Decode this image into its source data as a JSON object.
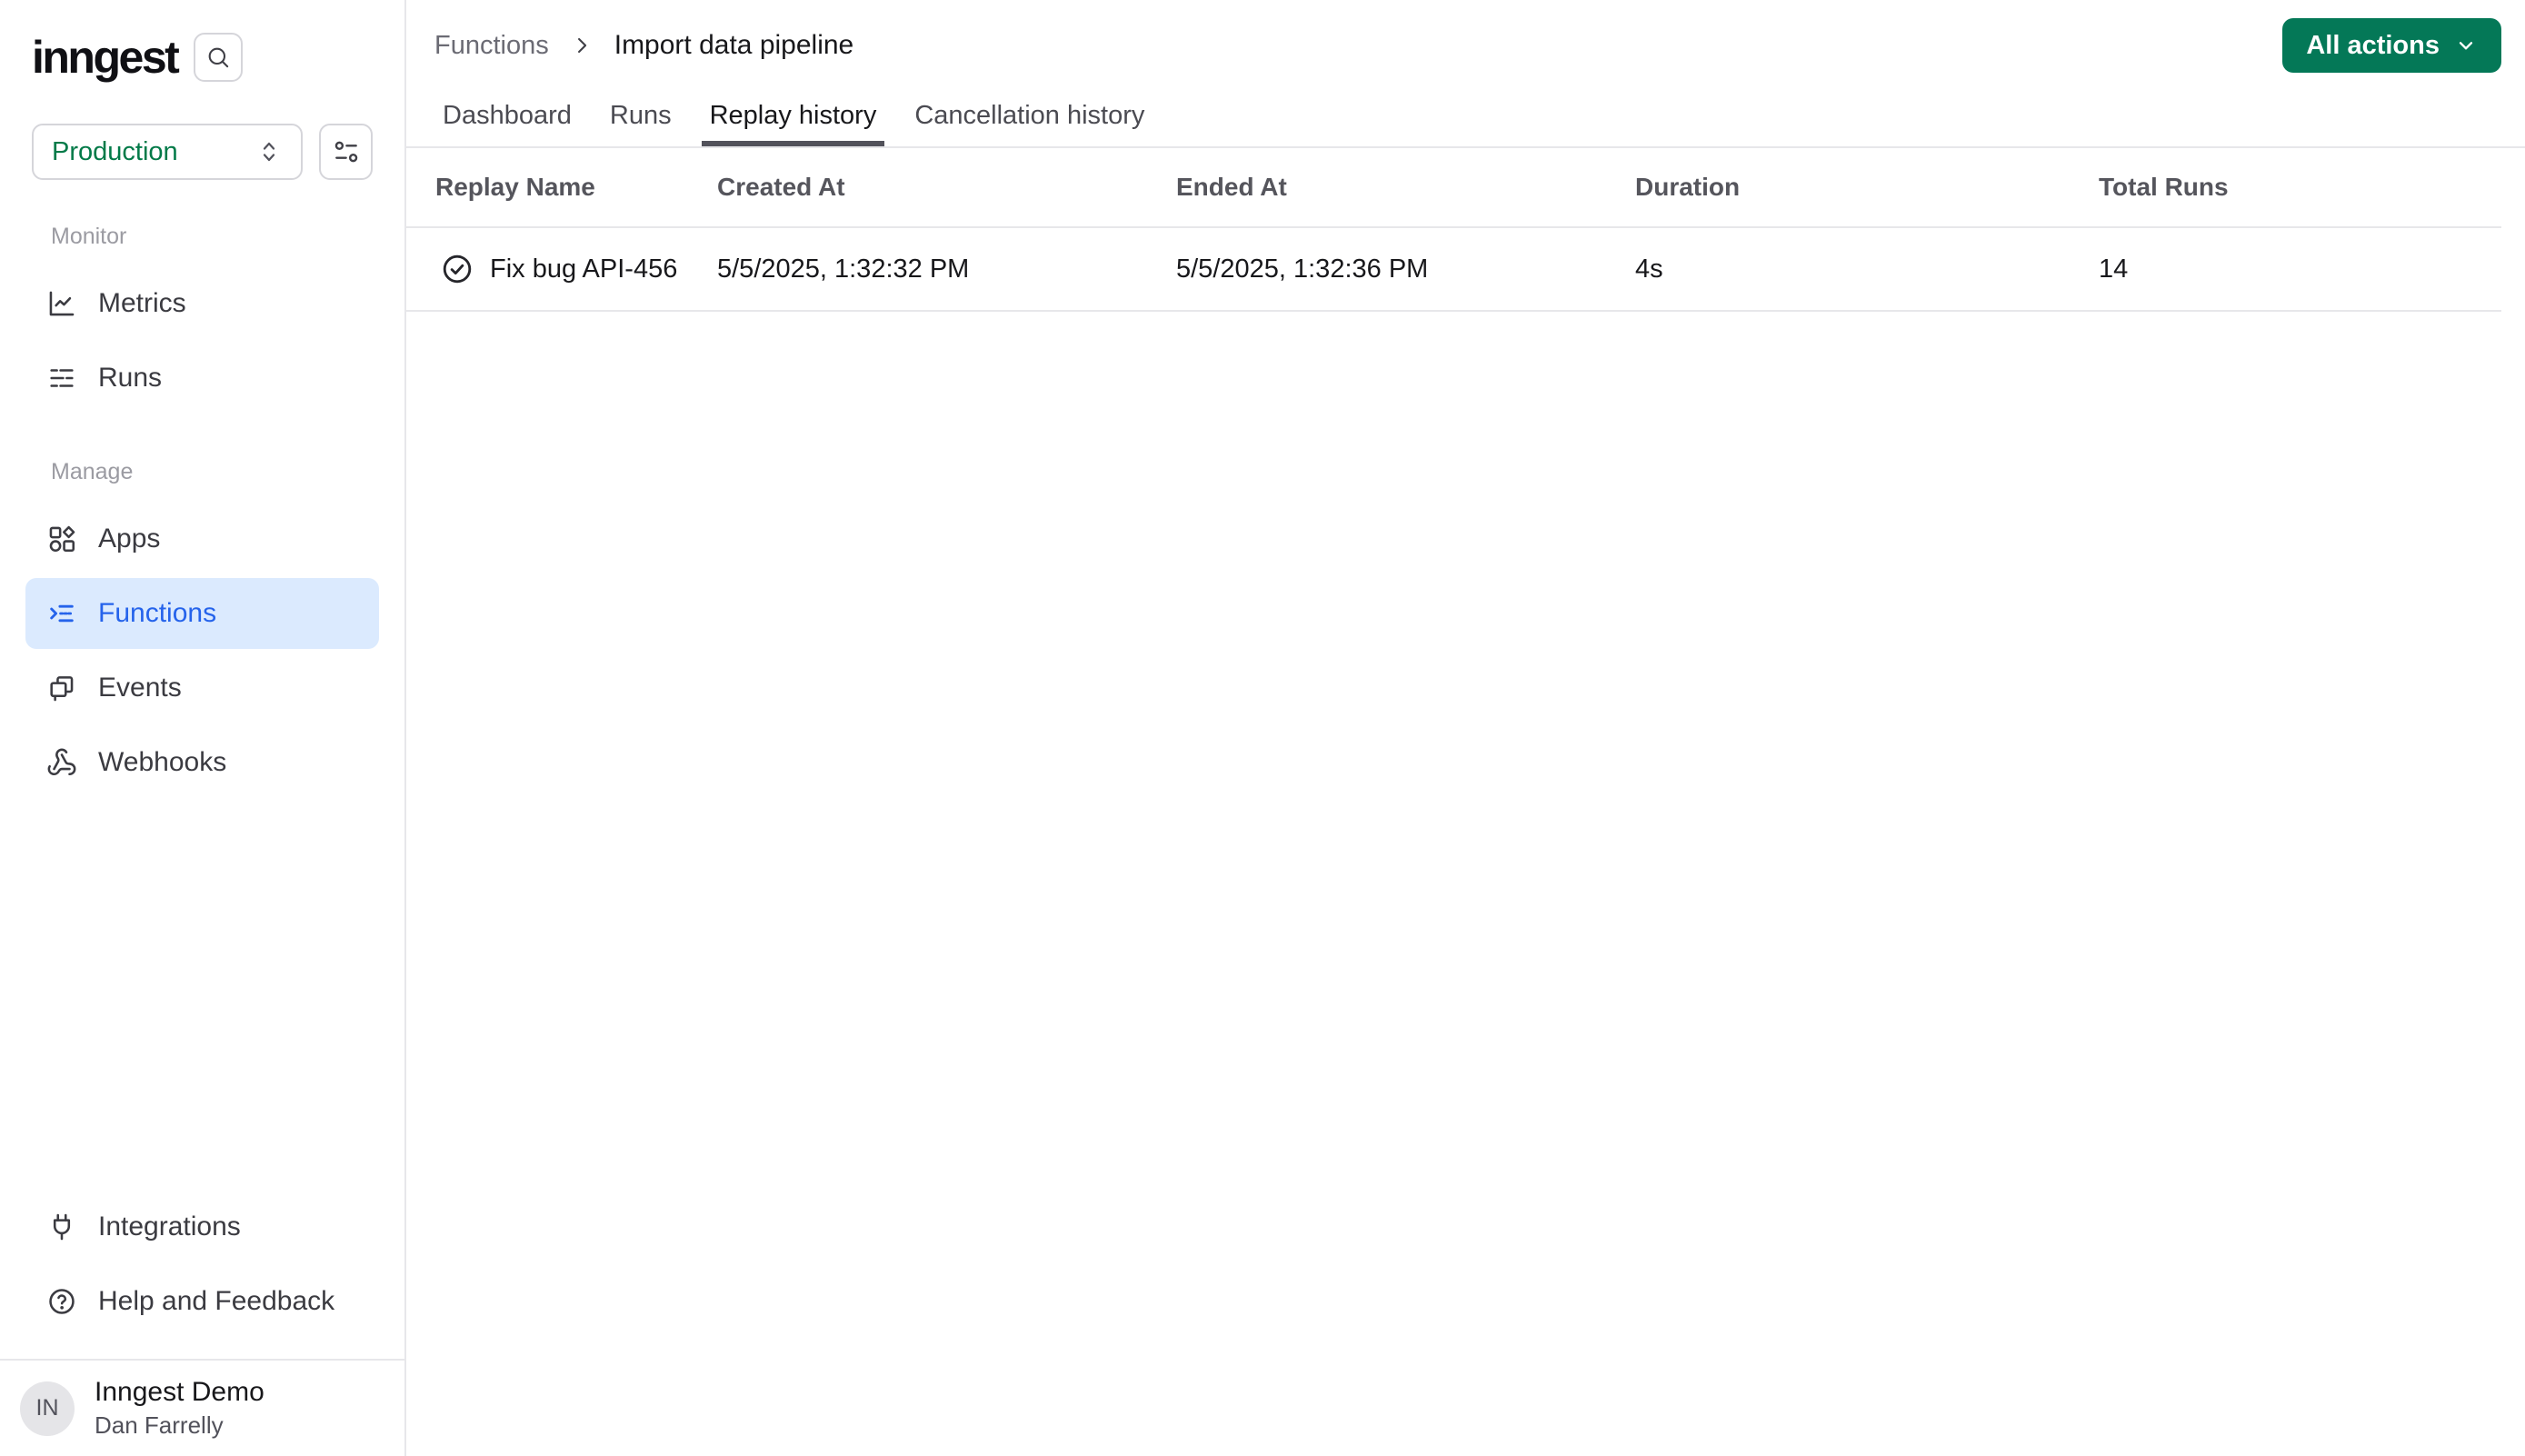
{
  "app": {
    "logo_text": "inngest"
  },
  "colors": {
    "accent_green": "#047857",
    "workspace_green": "#027a48",
    "active_blue": "#2563eb",
    "active_blue_bg": "#dbeafe",
    "divider": "#e7e7ea"
  },
  "sidebar": {
    "workspace": {
      "selected": "Production"
    },
    "sections": [
      {
        "label": "Monitor",
        "items": [
          {
            "label": "Metrics",
            "icon": "line-chart-icon"
          },
          {
            "label": "Runs",
            "icon": "runs-list-icon"
          }
        ]
      },
      {
        "label": "Manage",
        "items": [
          {
            "label": "Apps",
            "icon": "apps-icon"
          },
          {
            "label": "Functions",
            "icon": "functions-icon",
            "active": true
          },
          {
            "label": "Events",
            "icon": "events-icon"
          },
          {
            "label": "Webhooks",
            "icon": "webhook-icon"
          }
        ]
      }
    ],
    "footer_items": [
      {
        "label": "Integrations",
        "icon": "plug-icon"
      },
      {
        "label": "Help and Feedback",
        "icon": "help-circle-icon"
      }
    ],
    "user": {
      "initials": "IN",
      "org": "Inngest Demo",
      "name": "Dan Farrelly"
    }
  },
  "header": {
    "breadcrumb": {
      "root": "Functions",
      "current": "Import data pipeline"
    },
    "actions_button_label": "All actions"
  },
  "tabs": [
    {
      "label": "Dashboard"
    },
    {
      "label": "Runs"
    },
    {
      "label": "Replay history",
      "active": true
    },
    {
      "label": "Cancellation history"
    }
  ],
  "table": {
    "columns": [
      "Replay Name",
      "Created At",
      "Ended At",
      "Duration",
      "Total Runs"
    ],
    "rows": [
      {
        "status_icon": "check-circle-icon",
        "name": "Fix bug API-456",
        "created_at": "5/5/2025, 1:32:32 PM",
        "ended_at": "5/5/2025, 1:32:36 PM",
        "duration": "4s",
        "total_runs": "14"
      }
    ]
  }
}
